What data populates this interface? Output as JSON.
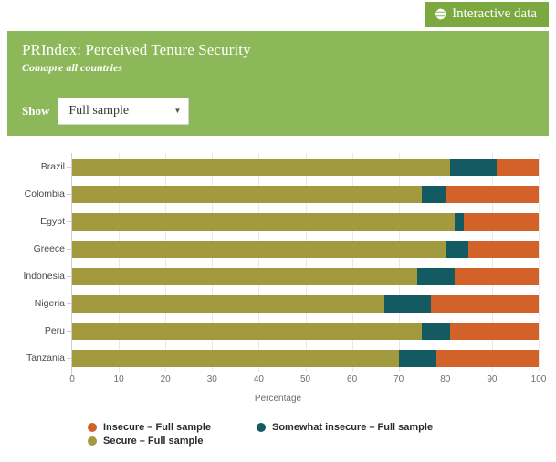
{
  "badge": {
    "label": "Interactive data",
    "icon": "globe-icon",
    "color": "#7ba93f"
  },
  "header": {
    "title": "PRIndex: Perceived Tenure Security",
    "subtitle": "Comapre all countries",
    "background_color": "#8cb85a"
  },
  "controls": {
    "show_label": "Show",
    "sample_select": {
      "value": "Full sample",
      "caret": "▼",
      "options": [
        "Full sample"
      ]
    }
  },
  "legend": {
    "items": [
      {
        "label": "Insecure – Full sample",
        "color": "#d2622a"
      },
      {
        "label": "Somewhat insecure – Full sample",
        "color": "#145a63"
      },
      {
        "label": "Secure – Full sample",
        "color": "#a39a40"
      }
    ]
  },
  "chart_data": {
    "type": "bar",
    "orientation": "horizontal",
    "stacked": true,
    "title": "PRIndex: Perceived Tenure Security",
    "subtitle": "Comapre all countries",
    "xlabel": "Percentage",
    "ylabel": "",
    "xlim": [
      0,
      100
    ],
    "xticks": [
      0,
      10,
      20,
      30,
      40,
      50,
      60,
      70,
      80,
      90,
      100
    ],
    "xtick_labels": [
      "0",
      "10",
      "20",
      "30",
      "40",
      "50",
      "60",
      "70",
      "80",
      "90",
      "100"
    ],
    "grid": true,
    "grid_axis": "x",
    "legend_position": "bottom-left",
    "categories": [
      "Brazil",
      "Colombia",
      "Egypt",
      "Greece",
      "Indonesia",
      "Nigeria",
      "Peru",
      "Tanzania"
    ],
    "series": [
      {
        "name": "Secure – Full sample",
        "color": "#a39a40",
        "values": [
          81,
          75,
          82,
          80,
          74,
          67,
          75,
          70
        ]
      },
      {
        "name": "Somewhat insecure – Full sample",
        "color": "#145a63",
        "values": [
          10,
          5,
          2,
          5,
          8,
          10,
          6,
          8
        ]
      },
      {
        "name": "Insecure – Full sample",
        "color": "#d2622a",
        "values": [
          9,
          20,
          16,
          15,
          18,
          23,
          19,
          22
        ]
      }
    ]
  }
}
